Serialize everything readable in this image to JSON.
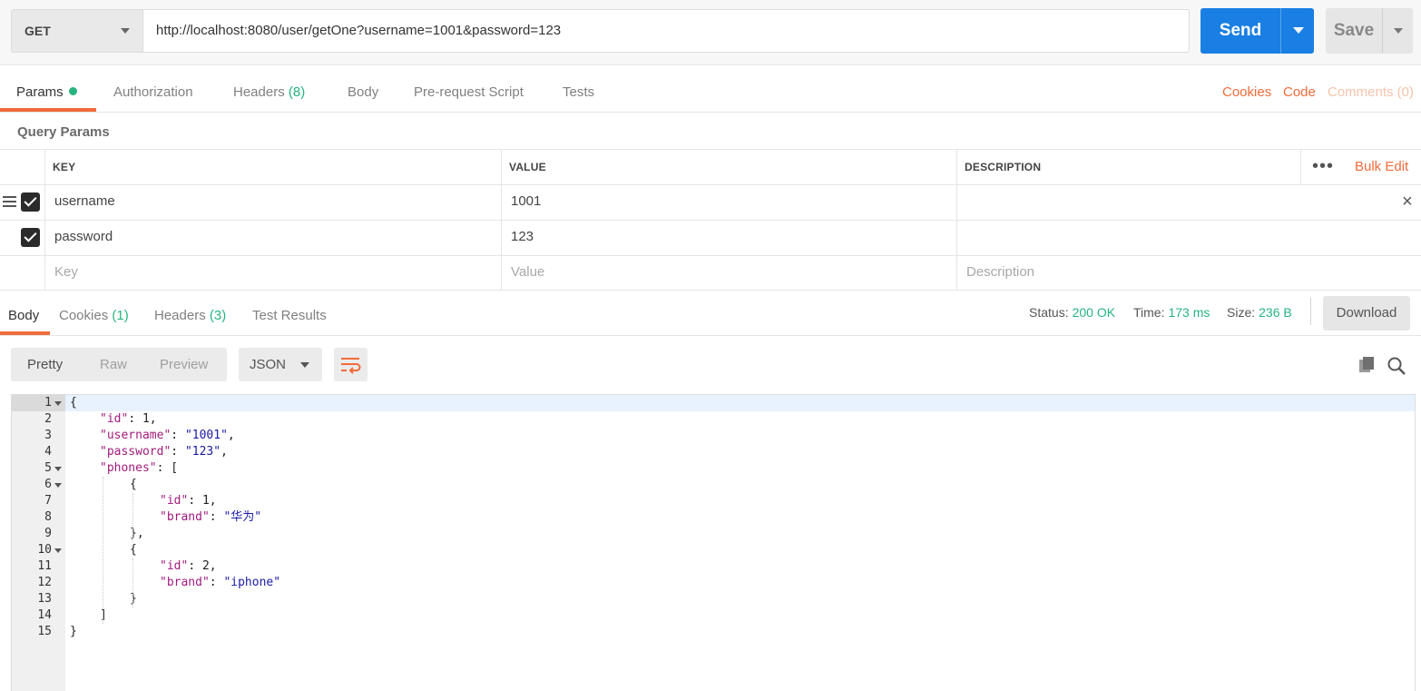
{
  "request": {
    "method": "GET",
    "url": "http://localhost:8080/user/getOne?username=1001&password=123",
    "send_label": "Send",
    "save_label": "Save"
  },
  "request_tabs": [
    {
      "label": "Params",
      "count": "",
      "active": true
    },
    {
      "label": "Authorization",
      "count": ""
    },
    {
      "label": "Headers",
      "count": "(8)"
    },
    {
      "label": "Body",
      "count": ""
    },
    {
      "label": "Pre-request Script",
      "count": ""
    },
    {
      "label": "Tests",
      "count": ""
    }
  ],
  "request_links": {
    "cookies": "Cookies",
    "code": "Code",
    "comments": "Comments (0)"
  },
  "query_params": {
    "title": "Query Params",
    "headers": {
      "key": "KEY",
      "value": "VALUE",
      "description": "DESCRIPTION"
    },
    "bulk_edit": "Bulk Edit",
    "more": "•••",
    "rows": [
      {
        "checked": true,
        "key": "username",
        "value": "1001",
        "description": ""
      },
      {
        "checked": true,
        "key": "password",
        "value": "123",
        "description": ""
      }
    ],
    "placeholders": {
      "key": "Key",
      "value": "Value",
      "description": "Description"
    }
  },
  "response_tabs": [
    {
      "label": "Body",
      "count": "",
      "active": true
    },
    {
      "label": "Cookies",
      "count": "(1)"
    },
    {
      "label": "Headers",
      "count": "(3)"
    },
    {
      "label": "Test Results",
      "count": ""
    }
  ],
  "response_status": {
    "status_label": "Status:",
    "status": "200 OK",
    "time_label": "Time:",
    "time": "173 ms",
    "size_label": "Size:",
    "size": "236 B",
    "download": "Download"
  },
  "response_view": {
    "modes": [
      "Pretty",
      "Raw",
      "Preview"
    ],
    "active_mode": "Pretty",
    "format": "JSON"
  },
  "colors": {
    "accent": "#f26b3a",
    "send": "#1a7fe3",
    "success": "#26b47f"
  },
  "icons": [
    "chevron-down-icon",
    "drag-handle-icon",
    "checkbox-icon",
    "close-icon",
    "more-icon",
    "wrap-lines-icon",
    "copy-icon",
    "search-icon",
    "fold-arrow-icon"
  ],
  "response_body": [
    {
      "n": "1",
      "fold": true,
      "indent": 0,
      "tokens": [
        [
          "n",
          "{"
        ]
      ]
    },
    {
      "n": "2",
      "indent": 1,
      "tokens": [
        [
          "k",
          "\"id\""
        ],
        [
          "n",
          ": 1,"
        ]
      ]
    },
    {
      "n": "3",
      "indent": 1,
      "tokens": [
        [
          "k",
          "\"username\""
        ],
        [
          "n",
          ": "
        ],
        [
          "s",
          "\"1001\""
        ],
        [
          "n",
          ","
        ]
      ]
    },
    {
      "n": "4",
      "indent": 1,
      "tokens": [
        [
          "k",
          "\"password\""
        ],
        [
          "n",
          ": "
        ],
        [
          "s",
          "\"123\""
        ],
        [
          "n",
          ","
        ]
      ]
    },
    {
      "n": "5",
      "fold": true,
      "indent": 1,
      "tokens": [
        [
          "k",
          "\"phones\""
        ],
        [
          "n",
          ": ["
        ]
      ]
    },
    {
      "n": "6",
      "fold": true,
      "indent": 2,
      "tokens": [
        [
          "n",
          "{"
        ]
      ]
    },
    {
      "n": "7",
      "indent": 3,
      "tokens": [
        [
          "k",
          "\"id\""
        ],
        [
          "n",
          ": 1,"
        ]
      ]
    },
    {
      "n": "8",
      "indent": 3,
      "tokens": [
        [
          "k",
          "\"brand\""
        ],
        [
          "n",
          ": "
        ],
        [
          "s",
          "\"华为\""
        ]
      ]
    },
    {
      "n": "9",
      "indent": 2,
      "tokens": [
        [
          "n",
          "},"
        ]
      ]
    },
    {
      "n": "10",
      "fold": true,
      "indent": 2,
      "tokens": [
        [
          "n",
          "{"
        ]
      ]
    },
    {
      "n": "11",
      "indent": 3,
      "tokens": [
        [
          "k",
          "\"id\""
        ],
        [
          "n",
          ": 2,"
        ]
      ]
    },
    {
      "n": "12",
      "indent": 3,
      "tokens": [
        [
          "k",
          "\"brand\""
        ],
        [
          "n",
          ": "
        ],
        [
          "s",
          "\"iphone\""
        ]
      ]
    },
    {
      "n": "13",
      "indent": 2,
      "tokens": [
        [
          "n",
          "}"
        ]
      ]
    },
    {
      "n": "14",
      "indent": 1,
      "tokens": [
        [
          "n",
          "]"
        ]
      ]
    },
    {
      "n": "15",
      "indent": 0,
      "tokens": [
        [
          "n",
          "}"
        ]
      ]
    }
  ]
}
